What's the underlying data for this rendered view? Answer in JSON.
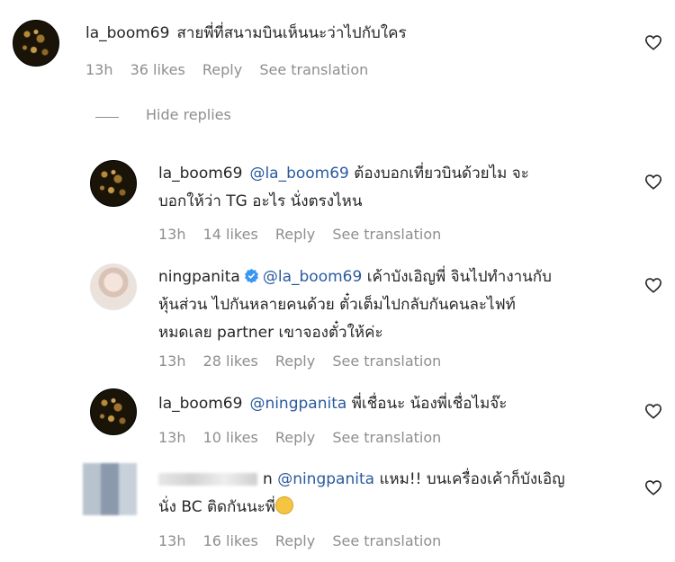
{
  "comments": [
    {
      "username": "la_boom69",
      "text": "สายพี่ที่สนามบินเห็นนะว่าไปกับใคร",
      "time": "13h",
      "likes": "36 likes",
      "reply": "Reply",
      "translate": "See translation"
    }
  ],
  "hide_replies": "Hide replies",
  "replies": [
    {
      "username": "la_boom69",
      "mention": "@la_boom69",
      "line1": "ต้องบอกเที่ยวบินด้วยไม",
      "line1_end": "จะ",
      "line2": "บอกให้ว่า TG อะไร นั่งตรงไหน",
      "time": "13h",
      "likes": "14 likes",
      "reply": "Reply",
      "translate": "See translation"
    },
    {
      "username": "ningpanita",
      "mention": "@la_boom69",
      "line1": "เค้าบังเอิญพี่ จินไปทำงานกับ",
      "line2": "หุ้นส่วน ไปกันหลายคนด้วย ตั๋วเต็มไปกลับกันคนละไฟท์",
      "line3": "หมดเลย partner เขาจองตั๋วให้ค่ะ",
      "time": "13h",
      "likes": "28 likes",
      "reply": "Reply",
      "translate": "See translation"
    },
    {
      "username": "la_boom69",
      "mention": "@ningpanita",
      "line1": "พี่เชื่อนะ น้องพี่เชื่อไมจ๊ะ",
      "time": "13h",
      "likes": "10 likes",
      "reply": "Reply",
      "translate": "See translation"
    },
    {
      "username_suffix": "n",
      "mention": "@ningpanita",
      "line1": "แหม!! บนเครื่องเค้าก็บังเอิญ",
      "line2": "นั่ง BC ติดกันนะพี่",
      "time": "13h",
      "likes": "16 likes",
      "reply": "Reply",
      "translate": "See translation"
    }
  ],
  "colors": {
    "mention": "#2a5a9e",
    "meta": "#8e8e8e",
    "verified": "#3897f0"
  },
  "icons": [
    "heart-icon",
    "verified-badge-icon",
    "grinning-emoji-icon"
  ]
}
